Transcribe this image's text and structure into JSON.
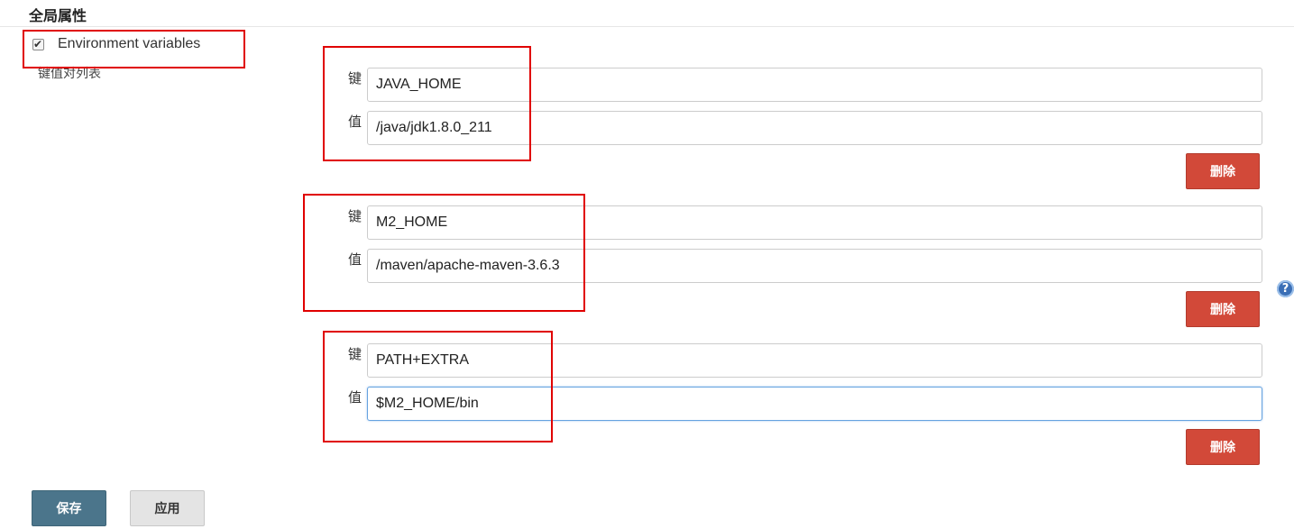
{
  "section": {
    "title": "全局属性"
  },
  "environment": {
    "checkbox_label": "Environment variables",
    "checked": true,
    "list_label": "键值对列表"
  },
  "entries": [
    {
      "key_label": "键",
      "value_label": "值",
      "key": "JAVA_HOME",
      "value": "/java/jdk1.8.0_211",
      "delete_label": "删除"
    },
    {
      "key_label": "键",
      "value_label": "值",
      "key": "M2_HOME",
      "value": "/maven/apache-maven-3.6.3",
      "delete_label": "删除"
    },
    {
      "key_label": "键",
      "value_label": "值",
      "key": "PATH+EXTRA",
      "value": "$M2_HOME/bin",
      "delete_label": "删除"
    }
  ],
  "help": {
    "icon": "help-icon",
    "glyph": "?"
  },
  "actions": {
    "save_label": "保存",
    "apply_label": "应用"
  },
  "colors": {
    "delete": "#d24939",
    "save": "#4b758b",
    "apply": "#e4e4e4",
    "annotation": "#e00000",
    "focus": "#66a3e0"
  }
}
